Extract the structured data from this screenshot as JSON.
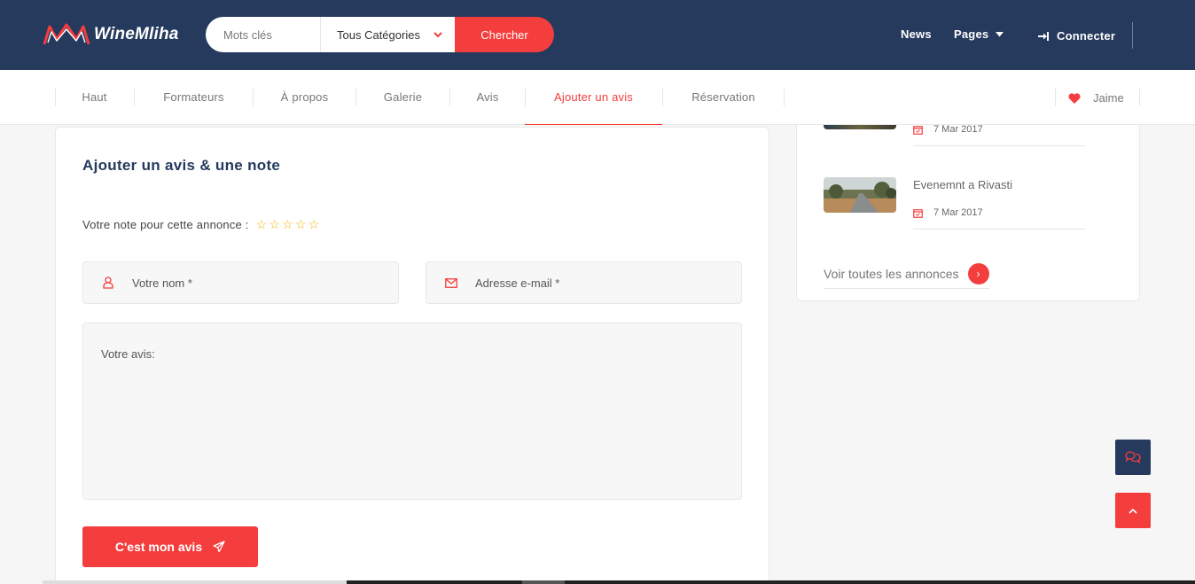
{
  "header": {
    "logo_text": "WineMliha",
    "search": {
      "keyword_placeholder": "Mots clés",
      "category_selected": "Tous Catégories",
      "search_label": "Chercher"
    },
    "nav": {
      "news": "News",
      "pages": "Pages",
      "login": "Connecter"
    }
  },
  "subnav": {
    "items": [
      "Haut",
      "Formateurs",
      "À propos",
      "Galerie",
      "Avis",
      "Ajouter un avis",
      "Réservation"
    ],
    "active_index": 5,
    "like_label": "Jaime"
  },
  "review_form": {
    "title": "Ajouter un avis & une note",
    "rating_label": "Votre note pour cette annonce :",
    "rating_value": 0,
    "rating_max": 5,
    "name_placeholder": "Votre nom *",
    "email_placeholder": "Adresse e-mail *",
    "review_placeholder": "Votre avis:",
    "submit_label": "C'est mon avis"
  },
  "sidebar": {
    "events": [
      {
        "title": "",
        "date": "7 Mar 2017"
      },
      {
        "title": "Evenemnt a Rivasti",
        "date": "7 Mar 2017"
      }
    ],
    "see_all_label": "Voir toutes les annonces"
  },
  "colors": {
    "header_bg": "#253a5d",
    "accent": "#f43d3d",
    "star": "#f4b400"
  }
}
